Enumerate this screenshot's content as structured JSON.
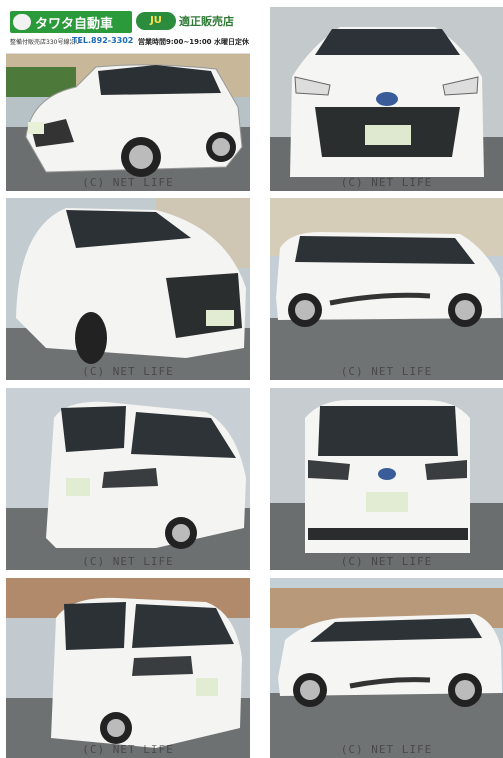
{
  "banner": {
    "dealer_name": "タワタ自動車",
    "dealer_sub": "整備付販売店330号線沿い",
    "phone": "TEL.892-3302",
    "ju_badge": "JU",
    "ju_text": "適正販売店",
    "hours": "営業時間9:00~19:00 水曜日定休"
  },
  "watermark": "(C) NET LIFE",
  "colors": {
    "brand_green": "#2a9a3a",
    "phone_blue": "#1c6bb5"
  }
}
